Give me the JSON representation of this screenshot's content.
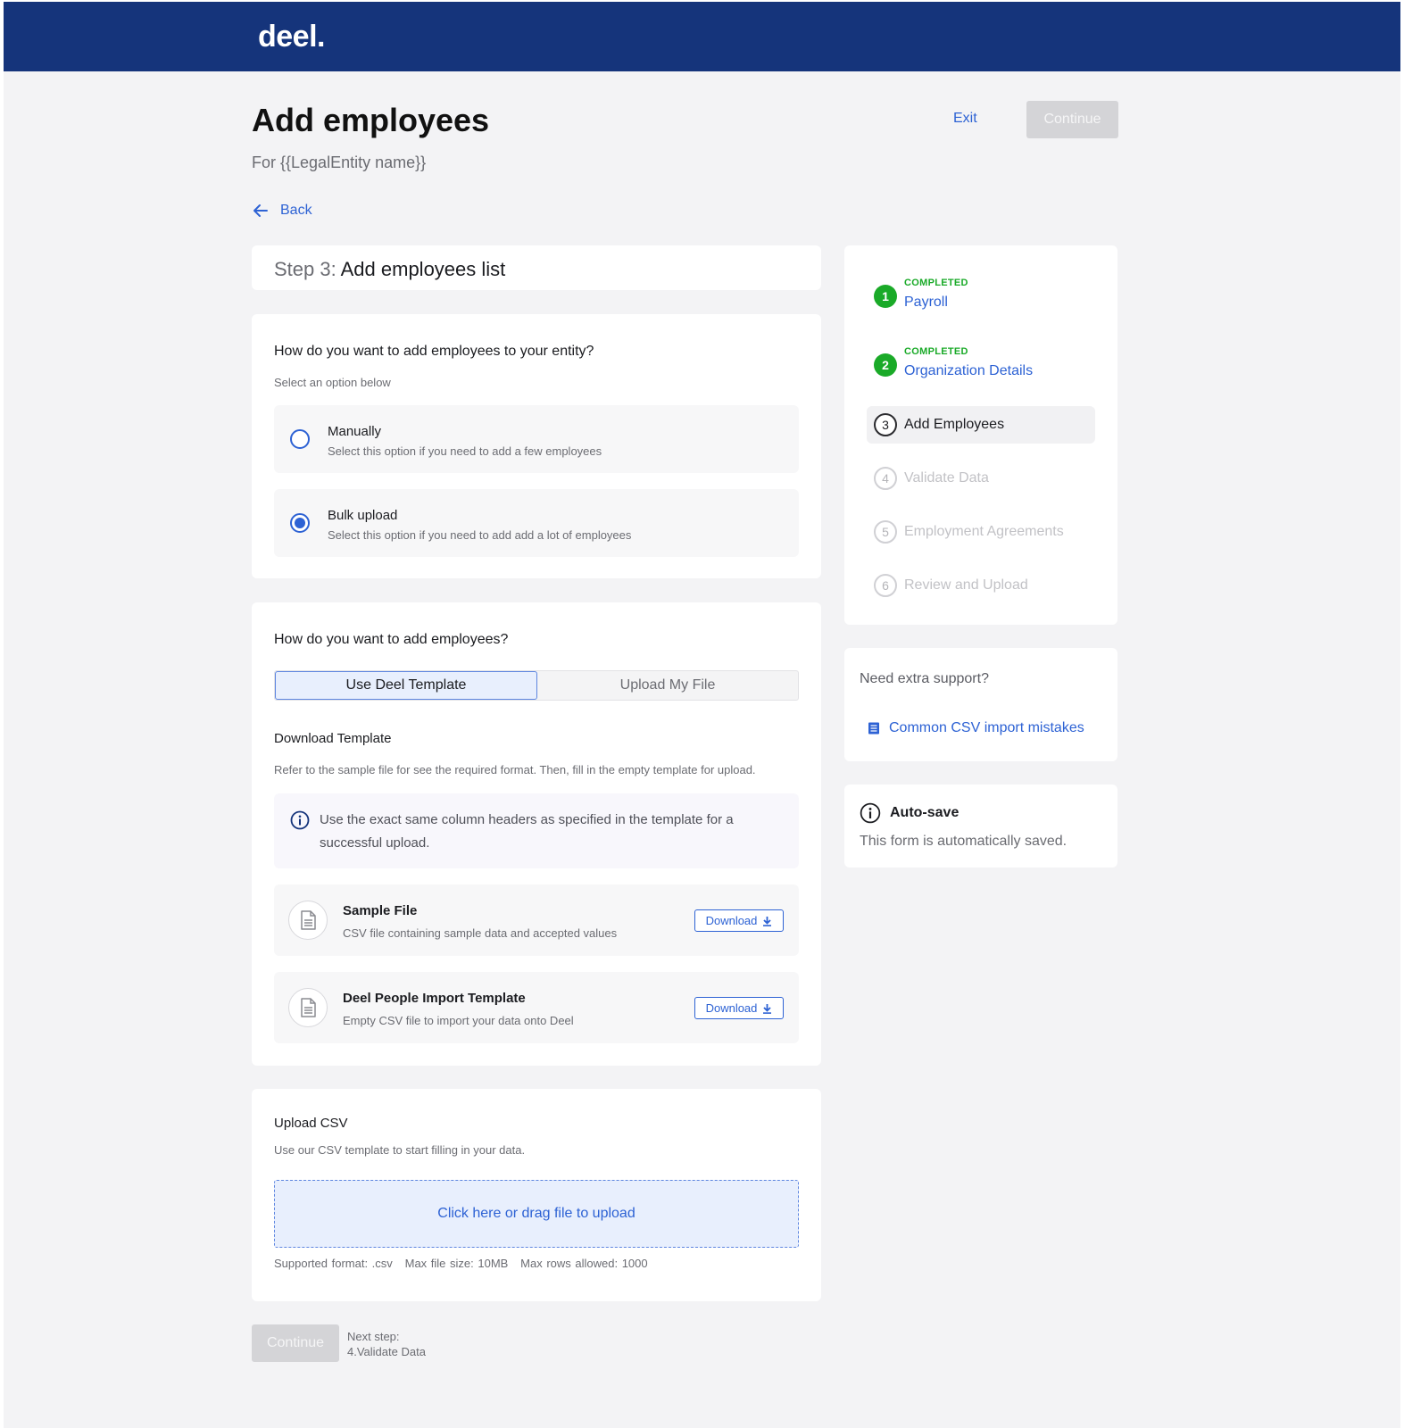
{
  "brand": {
    "logo": "deel."
  },
  "header": {
    "title": "Add employees",
    "subtitle": "For {{LegalEntity name}}",
    "exit_label": "Exit",
    "continue_label": "Continue",
    "back_label": "Back"
  },
  "step": {
    "prefix": "Step 3:",
    "title": "Add employees list"
  },
  "entity_method": {
    "question": "How do you want to add employees to your entity?",
    "hint": "Select an option below",
    "options": [
      {
        "title": "Manually",
        "desc": "Select this option if you need to add a few employees",
        "selected": false
      },
      {
        "title": "Bulk upload",
        "desc": "Select this option if you need to add add a lot of employees",
        "selected": true
      }
    ]
  },
  "add_method": {
    "question": "How do you want to add employees?",
    "tabs": [
      {
        "label": "Use Deel Template",
        "active": true
      },
      {
        "label": "Upload My File",
        "active": false
      }
    ],
    "download_title": "Download Template",
    "download_desc": "Refer to the sample file for see the required format. Then, fill in the empty template for upload.",
    "info": "Use the exact same column headers as specified in the template for a successful upload.",
    "files": [
      {
        "title": "Sample File",
        "desc": "CSV file containing sample data and accepted values",
        "button": "Download"
      },
      {
        "title": "Deel People Import Template",
        "desc": "Empty CSV file to import your data onto Deel",
        "button": "Download"
      }
    ]
  },
  "upload": {
    "title": "Upload CSV",
    "desc": "Use our CSV template to start filling in your data.",
    "dropzone": "Click here or drag file to upload",
    "meta": "Supported format: .csv   Max file size: 10MB   Max rows allowed: 1000"
  },
  "footer": {
    "continue_label": "Continue",
    "next_step_label": "Next step:",
    "next_step_value": "4.Validate Data"
  },
  "progress_steps": [
    {
      "num": "1",
      "name": "Payroll",
      "status": "COMPLETED",
      "state": "done"
    },
    {
      "num": "2",
      "name": "Organization Details",
      "status": "COMPLETED",
      "state": "done"
    },
    {
      "num": "3",
      "name": "Add Employees",
      "status": "",
      "state": "active"
    },
    {
      "num": "4",
      "name": "Validate Data",
      "status": "",
      "state": "todo"
    },
    {
      "num": "5",
      "name": "Employment Agreements",
      "status": "",
      "state": "todo"
    },
    {
      "num": "6",
      "name": "Review and Upload",
      "status": "",
      "state": "todo"
    }
  ],
  "support": {
    "title": "Need extra support?",
    "link": "Common CSV import mistakes"
  },
  "autosave": {
    "title": "Auto-save",
    "text": "This form is automatically saved."
  },
  "colors": {
    "brand_navy": "#15347b",
    "link_blue": "#2d62d4",
    "success_green": "#1aaa28",
    "disabled_gray": "#d4d4d7"
  },
  "icons": {
    "back": "arrow-left-icon",
    "info": "info-circle-icon",
    "file": "document-icon",
    "download": "download-arrow-icon",
    "doc_list": "document-lines-icon"
  }
}
